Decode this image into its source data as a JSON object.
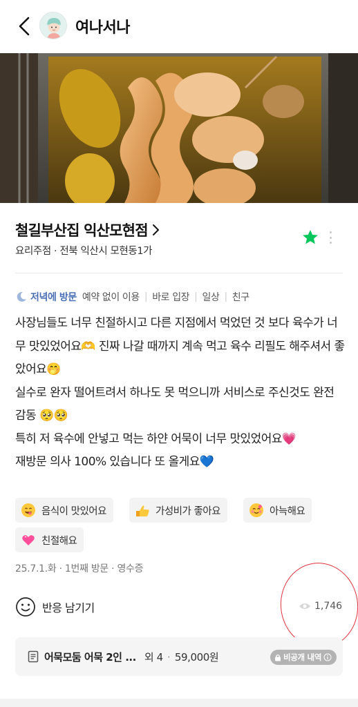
{
  "header": {
    "title": "여나서나"
  },
  "place": {
    "name": "철길부산집 익산모현점",
    "category": "요리주점",
    "location": "전북 익산시 모현동1가",
    "subtitle_sep": " · "
  },
  "visit_tags": {
    "primary": "저녁에 방문",
    "tags": [
      "예약 없이 이용",
      "바로 입장",
      "일상",
      "친구"
    ]
  },
  "review": {
    "text": "사장님들도 너무 친절하시고 다른 지점에서 먹었던 것 보다 육수가 너무 맛있었어요🫶 진짜 나갈 때까지 계속 먹고 육수 리필도 해주셔서 좋았어요🤭\n실수로 완자 떨어트려서 하나도 못 먹으니까 서비스로 주신것도 완전 감동 🥺🥺\n특히 저 육수에 안넣고 먹는 하얀 어묵이 너무 맛있었어요💗\n재방문 의사 100% 있습니다 또 올게요💙"
  },
  "keywords": [
    {
      "label": "음식이 맛있어요",
      "icon": "yum-face-icon"
    },
    {
      "label": "가성비가 좋아요",
      "icon": "thumbs-up-icon"
    },
    {
      "label": "아늑해요",
      "icon": "cozy-face-icon"
    },
    {
      "label": "친절해요",
      "icon": "heart-icon"
    }
  ],
  "visit_meta": "25.7.1.화 · 1번째 방문 · 영수증",
  "reaction": {
    "label": "반응 남기기"
  },
  "views": {
    "count": "1,746"
  },
  "order": {
    "menu": "어묵모둠 어묵 2인 ...",
    "extra": "외 4",
    "price": "59,000원",
    "private_badge": "비공개 내역"
  },
  "colors": {
    "accent_blue": "#4a6fb5",
    "star_green": "#03c75a",
    "annotation_red": "#e0333f"
  }
}
